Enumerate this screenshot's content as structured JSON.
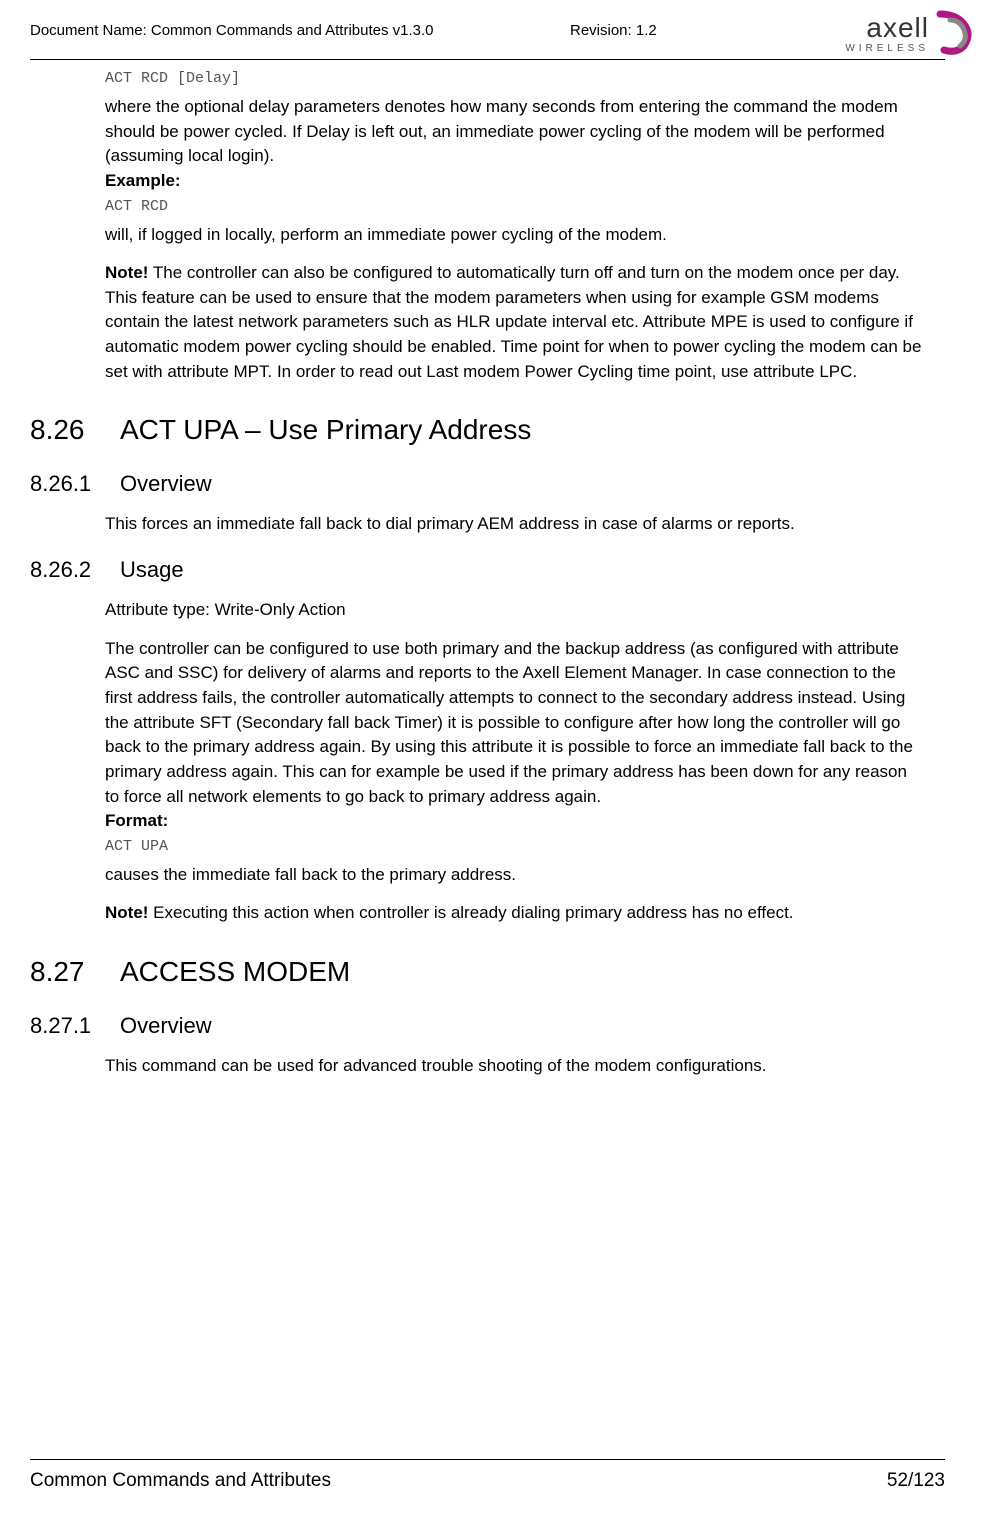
{
  "header": {
    "doc_name": "Document Name: Common Commands and Attributes v1.3.0",
    "revision": "Revision: 1.2",
    "logo_main": "axell",
    "logo_sub": "WIRELESS"
  },
  "sections": {
    "intro_code": "ACT RCD [Delay]",
    "intro_para": "where the optional delay parameters denotes how many seconds from entering the command the modem should be power cycled. If Delay is left out, an immediate power cycling of the modem will be performed (assuming local login).",
    "example_label": "Example:",
    "example_code": "ACT RCD",
    "example_desc": "will, if logged in locally, perform an immediate power cycling of the modem.",
    "note1_label": "Note!",
    "note1_text": " The controller can also be configured to automatically turn off and turn on the modem once per day. This feature can be used to ensure that the modem parameters when using for example GSM modems contain the latest network parameters such as HLR update interval etc. Attribute MPE is used to configure if automatic modem power cycling should be enabled. Time point for when to power cycling the modem can be set with attribute MPT. In order to read out Last modem Power Cycling time point, use attribute LPC.",
    "s826_num": "8.26",
    "s826_title": "ACT UPA – Use Primary Address",
    "s8261_num": "8.26.1",
    "s8261_title": "Overview",
    "s8261_text": "This forces an immediate fall back to dial primary AEM address in case of alarms or reports.",
    "s8262_num": "8.26.2",
    "s8262_title": "Usage",
    "s8262_attr": "Attribute type: Write-Only Action",
    "s8262_para": "The controller can be configured to use both primary and the backup address (as configured with attribute ASC and SSC) for delivery of alarms and reports to the Axell Element Manager. In case connection to the first address fails, the controller automatically attempts to connect to the secondary address instead. Using the attribute SFT (Secondary fall back Timer) it is possible to configure after how long the controller will go back to the primary address again. By using this attribute it is possible to force an immediate fall back to the primary address again. This can for example be used if the primary address has been down for any reason to force all network elements to go back to primary address again.",
    "format_label": "Format:",
    "format_code": "ACT UPA",
    "format_desc": "causes the immediate fall back to the primary address.",
    "note2_label": "Note!",
    "note2_text": " Executing this action when controller is already dialing primary address has no effect.",
    "s827_num": "8.27",
    "s827_title": "ACCESS MODEM",
    "s8271_num": "8.27.1",
    "s8271_title": "Overview",
    "s8271_text": "This command can be used for advanced trouble shooting of the modem configurations."
  },
  "footer": {
    "title": "Common Commands and Attributes",
    "page": "52/123"
  }
}
